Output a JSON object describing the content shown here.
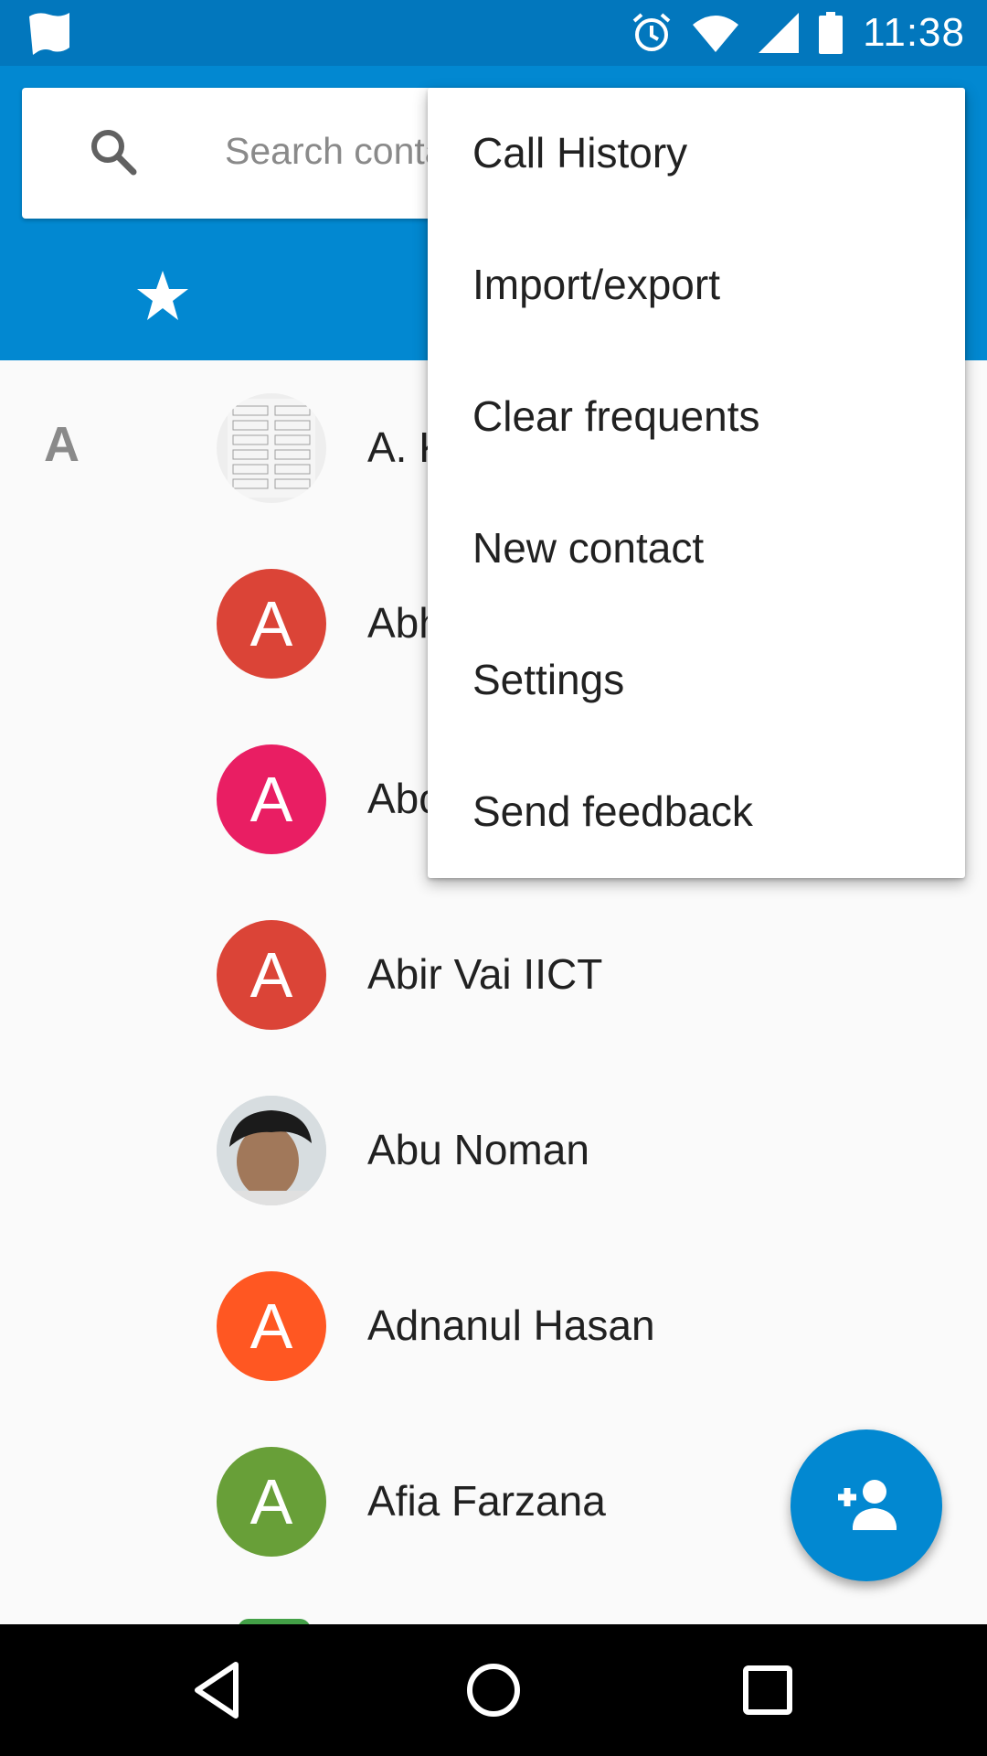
{
  "status_bar": {
    "time": "11:38",
    "icons": [
      "app-notification-icon",
      "alarm-icon",
      "wifi-icon",
      "cell-signal-icon",
      "battery-icon"
    ]
  },
  "search": {
    "placeholder": "Search conta"
  },
  "tabs": {
    "favorites_icon": "star-icon"
  },
  "section_letter": "A",
  "contacts": [
    {
      "name": "A. K",
      "avatar_type": "photo"
    },
    {
      "name": "Abh",
      "initial": "A",
      "color": "#db4437"
    },
    {
      "name": "Abc",
      "initial": "A",
      "color": "#e91e63"
    },
    {
      "name": "Abir Vai IICT",
      "initial": "A",
      "color": "#db4437"
    },
    {
      "name": "Abu Noman",
      "avatar_type": "photo"
    },
    {
      "name": "Adnanul Hasan",
      "initial": "A",
      "color": "#ff5722"
    },
    {
      "name": "Afia Farzana",
      "initial": "A",
      "color": "#689f38"
    }
  ],
  "menu": {
    "items": [
      "Call History",
      "Import/export",
      "Clear frequents",
      "New contact",
      "Settings",
      "Send feedback"
    ]
  },
  "fab": {
    "icon": "add-person-icon"
  },
  "colors": {
    "primary": "#0288d1",
    "primary_dark": "#0277bd"
  }
}
